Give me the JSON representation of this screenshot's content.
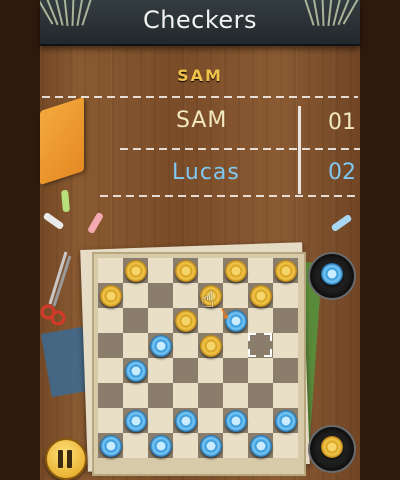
{
  "app": {
    "title": "Checkers"
  },
  "turn": {
    "current_player": "SAM"
  },
  "scores": [
    {
      "name": "SAM",
      "score": "01"
    },
    {
      "name": "Lucas",
      "score": "02"
    }
  ],
  "colors": {
    "player1": "#f3e9c0",
    "player2": "#7ec8f3",
    "turn_text": "#f0c34a"
  },
  "board": {
    "rows": 8,
    "cols": 8,
    "gold_pieces": [
      [
        0,
        1
      ],
      [
        0,
        3
      ],
      [
        0,
        5
      ],
      [
        0,
        7
      ],
      [
        1,
        0
      ],
      [
        1,
        4
      ],
      [
        1,
        6
      ],
      [
        2,
        3
      ],
      [
        3,
        4
      ]
    ],
    "blue_pieces": [
      [
        2,
        5
      ],
      [
        3,
        2
      ],
      [
        4,
        1
      ],
      [
        6,
        1
      ],
      [
        6,
        3
      ],
      [
        6,
        5
      ],
      [
        6,
        7
      ],
      [
        7,
        0
      ],
      [
        7,
        2
      ],
      [
        7,
        4
      ],
      [
        7,
        6
      ]
    ],
    "selected_square": [
      3,
      6
    ]
  },
  "captured": {
    "top_tray": "blue",
    "bottom_tray": "gold"
  },
  "controls": {
    "pause_icon": "pause-icon"
  }
}
